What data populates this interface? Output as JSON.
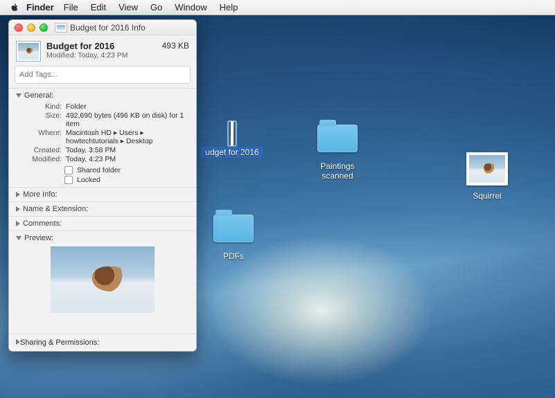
{
  "menubar": {
    "app": "Finder",
    "items": [
      "File",
      "Edit",
      "View",
      "Go",
      "Window",
      "Help"
    ]
  },
  "desktop": {
    "icons": [
      {
        "name": "udget for 2016",
        "kind": "thumb",
        "selected": true
      },
      {
        "name": "Paintings scanned",
        "kind": "folder",
        "selected": false
      },
      {
        "name": "Squirrel",
        "kind": "thumb",
        "selected": false
      },
      {
        "name": "PDFs",
        "kind": "folder",
        "selected": false
      }
    ]
  },
  "info": {
    "window_title": "Budget for 2016 Info",
    "title": "Budget for 2016",
    "modified_sub": "Modified: Today, 4:23 PM",
    "size_badge": "493 KB",
    "tags_placeholder": "Add Tags...",
    "sections": {
      "general": {
        "label": "General:",
        "rows": {
          "kind_k": "Kind:",
          "kind_v": "Folder",
          "size_k": "Size:",
          "size_v": "492,690 bytes (496 KB on disk) for 1 item",
          "where_k": "Where:",
          "where_v": "Macintosh HD ▸ Users ▸ howtechtutorials ▸ Desktop",
          "created_k": "Created:",
          "created_v": "Today, 3:58 PM",
          "modified_k": "Modified:",
          "modified_v": "Today, 4:23 PM"
        },
        "shared_label": "Shared folder",
        "locked_label": "Locked"
      },
      "more_info": "More Info:",
      "name_ext": "Name & Extension:",
      "comments": "Comments:",
      "preview": "Preview:",
      "sharing": "Sharing & Permissions:"
    }
  }
}
